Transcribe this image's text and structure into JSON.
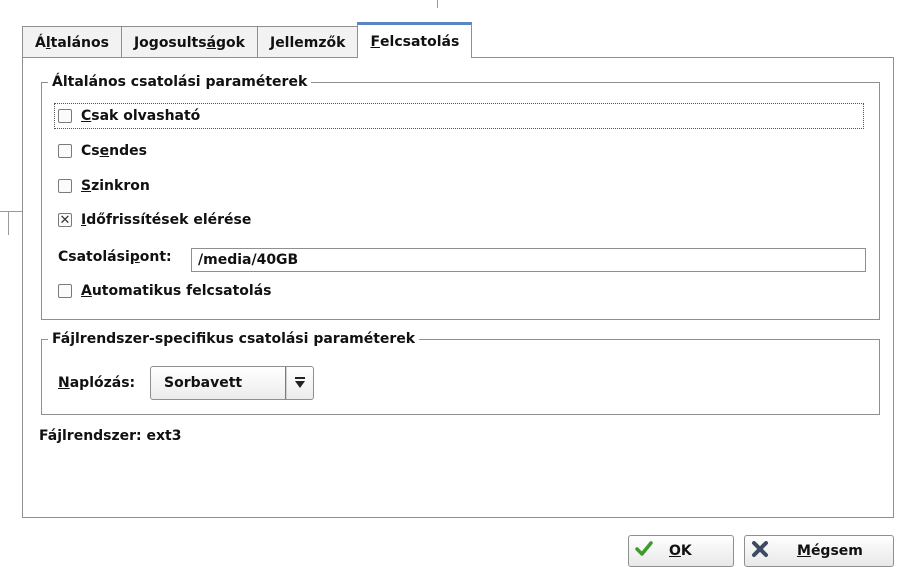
{
  "tabs": [
    {
      "label_pre": "Á",
      "label_u": "l",
      "label_post": "talános"
    },
    {
      "label_pre": "Jogosults",
      "label_u": "á",
      "label_post": "gok"
    },
    {
      "label_pre": "",
      "label_u": "J",
      "label_post": "ellemzők"
    },
    {
      "label_pre": "",
      "label_u": "F",
      "label_post": "elcsatolás"
    }
  ],
  "active_tab": "Felcsatolás",
  "general_group": {
    "title": "Általános csatolási paraméterek",
    "options": [
      {
        "u": "C",
        "rest": "sak olvasható",
        "checked": false,
        "pre": ""
      },
      {
        "pre": "Cs",
        "u": "e",
        "rest": "ndes",
        "checked": false
      },
      {
        "pre": "",
        "u": "S",
        "rest": "zinkron",
        "checked": false
      },
      {
        "pre": "",
        "u": "I",
        "rest": "dőfrissítések elérése",
        "checked": true
      }
    ],
    "mount_point": {
      "label_pre": "Csatolási ",
      "label_u": "p",
      "label_post": "ont:",
      "value": "/media/40GB"
    },
    "auto_mount": {
      "pre": "",
      "u": "A",
      "rest": "utomatikus felcsatolás",
      "checked": false
    }
  },
  "fs_group": {
    "title": "Fájlrendszer-specifikus csatolási paraméterek",
    "journal_label_u": "N",
    "journal_label_rest": "aplózás:",
    "journal_value": "Sorbavett"
  },
  "filesystem_text": "Fájlrendszer: ext3",
  "buttons": {
    "ok_u": "O",
    "ok_rest": "K",
    "cancel_u": "M",
    "cancel_rest": "égsem"
  },
  "colors": {
    "tab_accent": "#5a86c0",
    "ok_icon": "#3f9a2e",
    "cancel_icon": "#3d4b63"
  }
}
